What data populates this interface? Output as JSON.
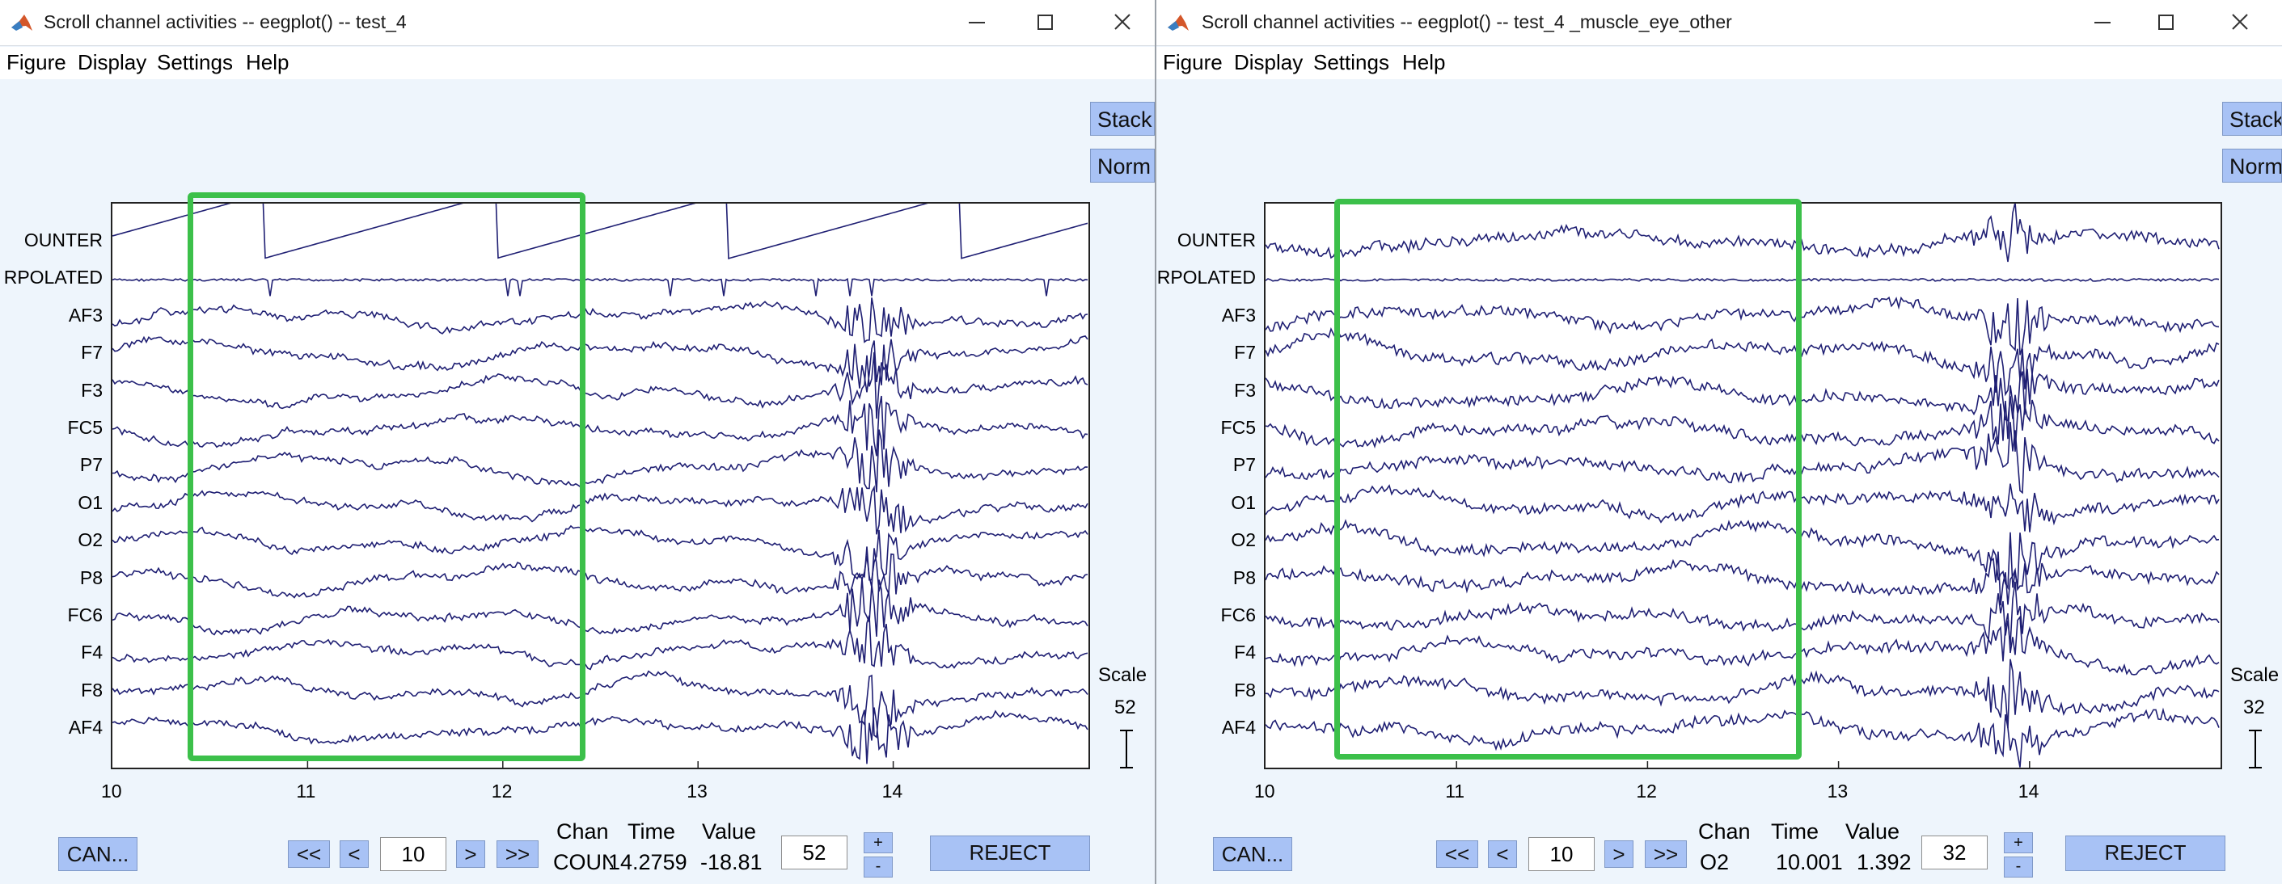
{
  "windows": [
    {
      "title": "Scroll channel activities -- eegplot() -- test_4",
      "menu": [
        "Figure",
        "Display",
        "Settings",
        "Help"
      ],
      "stack_label": "Stack",
      "norm_label": "Norm",
      "channels": [
        "OUNTER",
        "RPOLATED",
        "AF3",
        "F7",
        "F3",
        "FC5",
        "P7",
        "O1",
        "O2",
        "P8",
        "FC6",
        "F4",
        "F8",
        "AF4"
      ],
      "xticks": [
        "10",
        "11",
        "12",
        "13",
        "14"
      ],
      "scale_title": "Scale",
      "scale_value": "52",
      "cancel_label": "CAN...",
      "nav": {
        "first": "<<",
        "prev": "<",
        "window_start": "10",
        "next": ">",
        "last": ">>"
      },
      "readout": {
        "chan_header": "Chan",
        "time_header": "Time",
        "value_header": "Value",
        "chan": "COUN",
        "time": "14.2759",
        "value": "-18.81"
      },
      "scale_input": "52",
      "plus": "+",
      "minus": "-",
      "reject_label": "REJECT",
      "seed": 7,
      "artifact": "muscle"
    },
    {
      "title": "Scroll channel activities -- eegplot() -- test_4 _muscle_eye_other",
      "menu": [
        "Figure",
        "Display",
        "Settings",
        "Help"
      ],
      "stack_label": "Stack",
      "norm_label": "Norm",
      "channels": [
        "OUNTER",
        "RPOLATED",
        "AF3",
        "F7",
        "F3",
        "FC5",
        "P7",
        "O1",
        "O2",
        "P8",
        "FC6",
        "F4",
        "F8",
        "AF4"
      ],
      "xticks": [
        "10",
        "11",
        "12",
        "13",
        "14"
      ],
      "scale_title": "Scale",
      "scale_value": "32",
      "cancel_label": "CAN...",
      "nav": {
        "first": "<<",
        "prev": "<",
        "window_start": "10",
        "next": ">",
        "last": ">>"
      },
      "readout": {
        "chan_header": "Chan",
        "time_header": "Time",
        "value_header": "Value",
        "chan": "O2",
        "time": "10.001",
        "value": "1.392"
      },
      "scale_input": "32",
      "plus": "+",
      "minus": "-",
      "reject_label": "REJECT",
      "seed": 19,
      "artifact": "muscle"
    }
  ],
  "colors": {
    "trace": "#1f1f73",
    "highlight": "#3cc04a",
    "button": "#a8c2f5",
    "background": "#eef5fc"
  },
  "icons": {
    "app": "matlab-icon",
    "minimize": "minimize-icon",
    "maximize": "maximize-icon",
    "close": "close-icon"
  }
}
